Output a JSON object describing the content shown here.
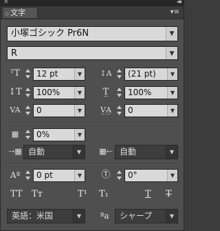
{
  "panel": {
    "tab_label": "文字",
    "tab_prefix_icon": "double-chevron-icon",
    "close_glyph": "×",
    "collapse_glyph": "◂◂",
    "menu_glyph": "▾≡"
  },
  "font": {
    "family": "小塚ゴシック Pr6N",
    "style": "R"
  },
  "metrics": {
    "font_size": "12 pt",
    "leading": "(21 pt)",
    "vertical_scale": "100%",
    "horizontal_scale": "100%",
    "kerning": "0",
    "tracking": "0",
    "tsume": "0%",
    "aki_left": "自動",
    "aki_right": "自動",
    "baseline_shift": "0 pt",
    "rotation": "0°"
  },
  "style_buttons": [
    "TT",
    "Tт",
    "T¹",
    "T₁",
    "T",
    "T"
  ],
  "language": "英語：米国",
  "antialias": {
    "icon_text": "ªa",
    "value": "シャープ"
  }
}
